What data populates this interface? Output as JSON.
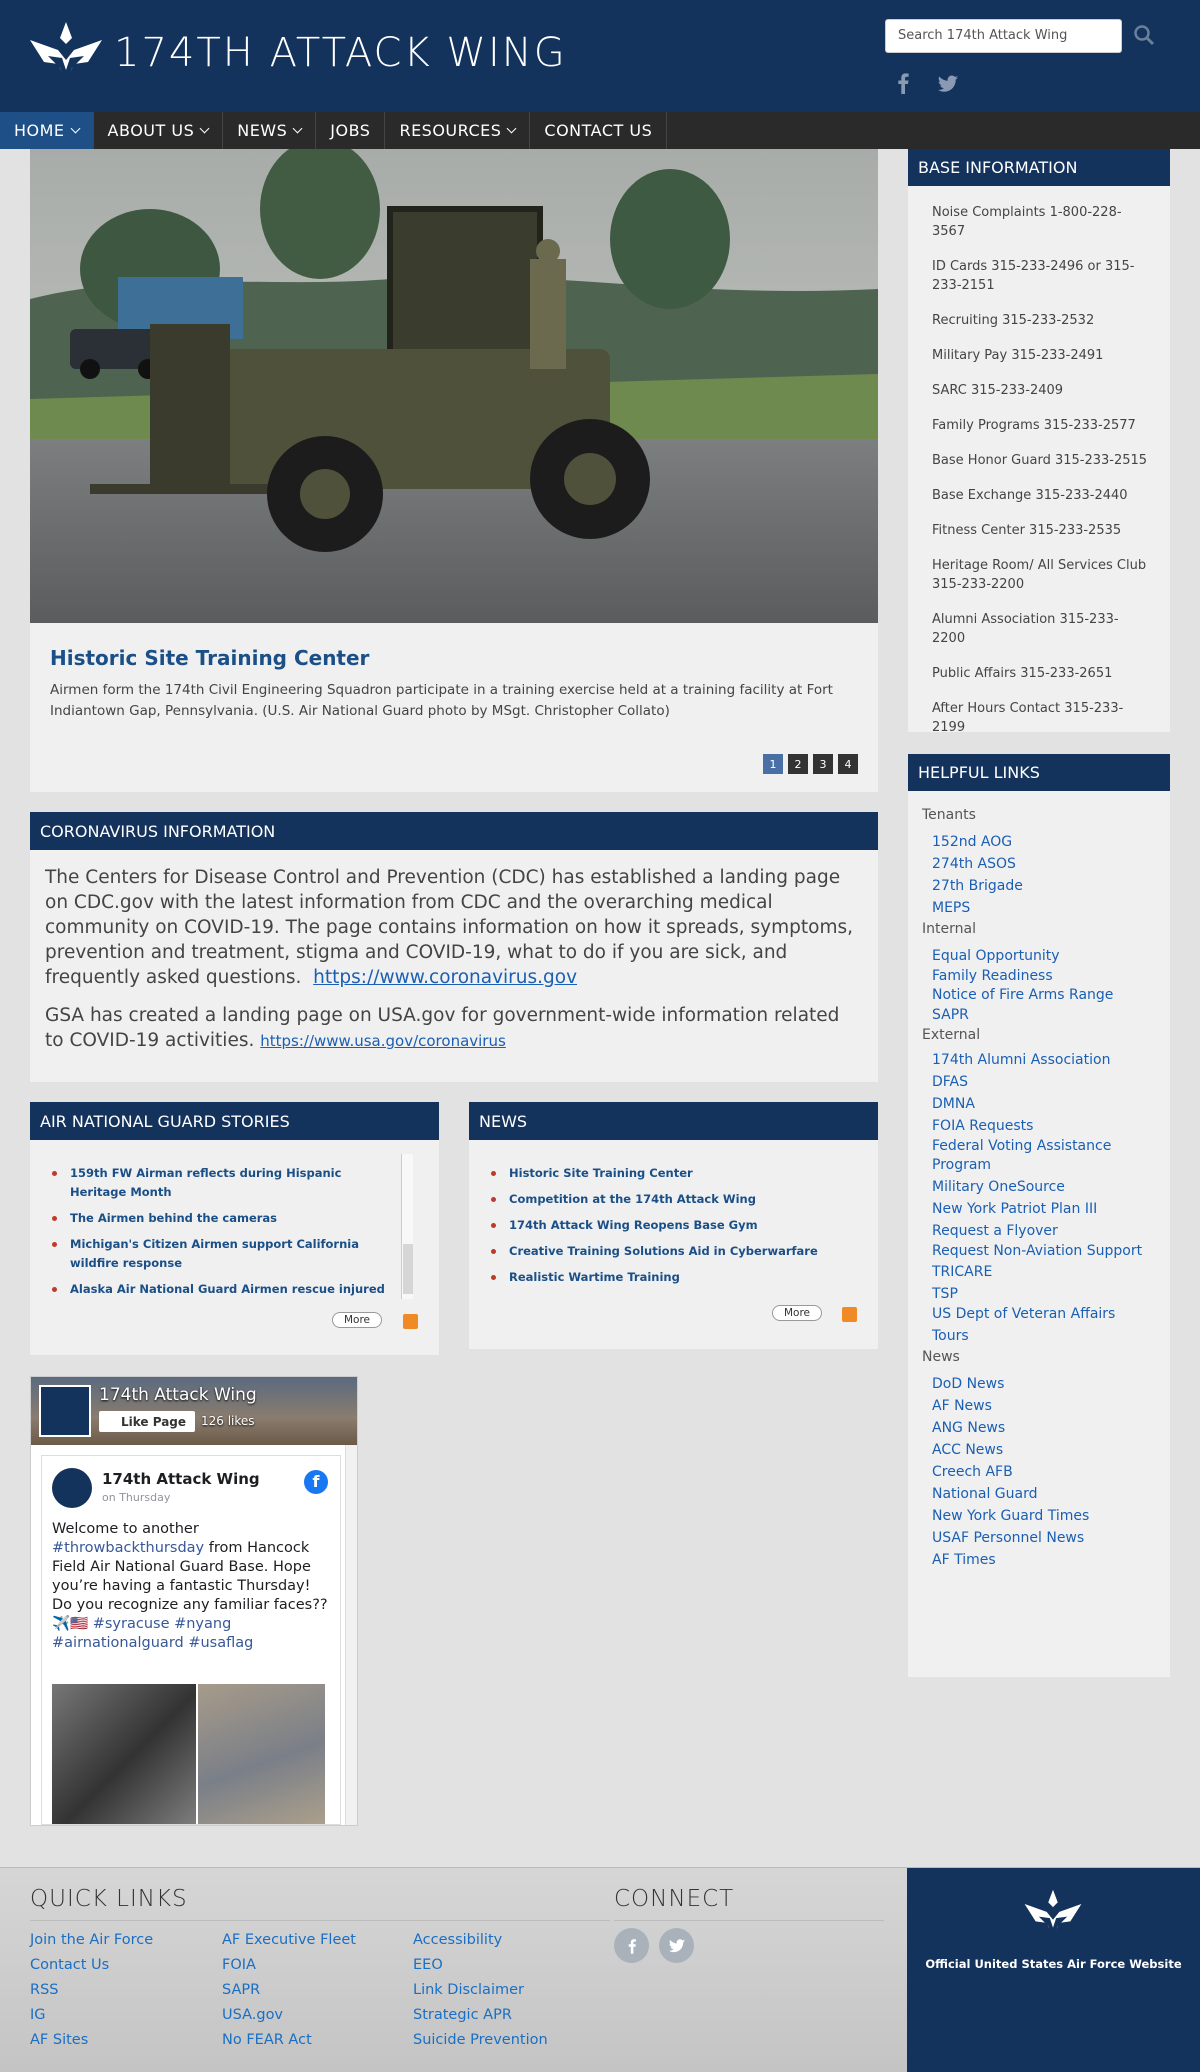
{
  "header": {
    "title": "174TH ATTACK WING",
    "search_placeholder": "Search 174th Attack Wing"
  },
  "nav": {
    "items": [
      {
        "label": "HOME",
        "dropdown": true,
        "active": true
      },
      {
        "label": "ABOUT US",
        "dropdown": true
      },
      {
        "label": "NEWS",
        "dropdown": true
      },
      {
        "label": "JOBS",
        "dropdown": false
      },
      {
        "label": "RESOURCES",
        "dropdown": true
      },
      {
        "label": "CONTACT US",
        "dropdown": false
      }
    ]
  },
  "hero": {
    "title": "Historic Site Training Center",
    "caption": "Airmen form the 174th Civil Engineering Squadron participate in a training exercise held at a training facility at Fort Indiantown Gap, Pennsylvania. (U.S. Air National Guard photo by MSgt. Christopher Collato)",
    "pages": [
      "1",
      "2",
      "3",
      "4"
    ],
    "active_page": "1"
  },
  "covid": {
    "heading": "CORONAVIRUS INFORMATION",
    "p1": "The Centers for Disease Control and Prevention (CDC) has established a landing page on CDC.gov with the latest information from CDC and the overarching medical community on COVID-19. The page contains information on how it spreads, symptoms, prevention and treatment, stigma and COVID-19, what to do if you are sick, and frequently asked questions.",
    "link1": "https://www.coronavirus.gov",
    "p2": "GSA has created a landing page on USA.gov for government-wide information related to COVID-19 activities.",
    "link2": "https://www.usa.gov/coronavirus"
  },
  "stories": {
    "heading": "AIR NATIONAL GUARD STORIES",
    "items": [
      "159th FW Airman reflects during Hispanic Heritage Month",
      "The Airmen behind the cameras",
      "Michigan's Citizen Airmen support California wildfire response",
      "Alaska Air National Guard Airmen rescue injured"
    ],
    "more": "More"
  },
  "news": {
    "heading": "NEWS",
    "items": [
      "Historic Site Training Center",
      "Competition at the 174th Attack Wing",
      "174th Attack Wing Reopens Base Gym",
      "Creative Training Solutions Aid in Cyberwarfare",
      "Realistic Wartime Training"
    ],
    "more": "More"
  },
  "facebook": {
    "page_name": "174th Attack Wing",
    "like_label": "Like Page",
    "likes": "126 likes",
    "post_author": "174th Attack Wing",
    "post_date": "on Thursday",
    "post_text_1": "Welcome to another",
    "post_tag_1": "#throwbackthursday",
    "post_text_2": "from Hancock Field Air National Guard Base. Hope you’re having a fantastic Thursday! Do you recognize any familiar faces??",
    "post_emoji": "✈️🇺🇸",
    "post_tags_2": "#syracuse #nyang",
    "post_tags_3": "#airnationalguard #usaflag"
  },
  "base_info": {
    "heading": "BASE INFORMATION",
    "items": [
      "Noise Complaints 1-800-228-3567",
      "ID Cards 315-233-2496 or 315-233-2151",
      "Recruiting 315-233-2532",
      "Military Pay 315-233-2491",
      "SARC 315-233-2409",
      "Family Programs 315-233-2577",
      "Base Honor Guard 315-233-2515",
      "Base Exchange 315-233-2440",
      "Fitness Center 315-233-2535",
      "Heritage Room/ All Services Club 315-233-2200",
      "Alumni Association 315-233-2200",
      "Public Affairs 315-233-2651",
      "After Hours Contact 315-233-2199"
    ]
  },
  "helpful_links": {
    "heading": "HELPFUL LINKS",
    "groups": [
      {
        "name": "Tenants",
        "links": [
          "152nd AOG",
          "274th ASOS",
          "27th Brigade",
          "MEPS"
        ]
      },
      {
        "name": "Internal",
        "links": [
          "Equal Opportunity",
          "Family Readiness",
          "Notice of Fire Arms Range",
          "SAPR"
        ]
      },
      {
        "name": "External",
        "links": [
          "174th Alumni Association",
          "DFAS",
          "DMNA",
          "FOIA Requests",
          "Federal Voting Assistance Program",
          "Military OneSource",
          "New York Patriot Plan III",
          "Request a Flyover",
          "Request Non-Aviation Support",
          "TRICARE",
          "TSP",
          "US Dept of Veteran Affairs",
          "Tours"
        ]
      },
      {
        "name": "News",
        "links": [
          "DoD News",
          "AF News",
          "ANG News",
          "ACC News",
          "Creech AFB",
          "National Guard",
          "New York Guard Times",
          "USAF Personnel News",
          "AF Times"
        ]
      }
    ]
  },
  "footer": {
    "quick_links_heading": "QUICK LINKS",
    "connect_heading": "CONNECT",
    "col1": [
      "Join the Air Force",
      "Contact Us",
      "RSS",
      "IG",
      "AF Sites"
    ],
    "col2": [
      "AF Executive Fleet",
      "FOIA",
      "SAPR",
      "USA.gov",
      "No FEAR Act"
    ],
    "col3": [
      "Accessibility",
      "EEO",
      "Link Disclaimer",
      "Strategic APR",
      "Suicide Prevention"
    ],
    "af_site": "Official United States Air Force Website"
  },
  "colors": {
    "navy": "#13325c",
    "nav_dark": "#2a2a2a",
    "link_blue": "#1a5fb4",
    "bullet_red": "#c0392b"
  }
}
